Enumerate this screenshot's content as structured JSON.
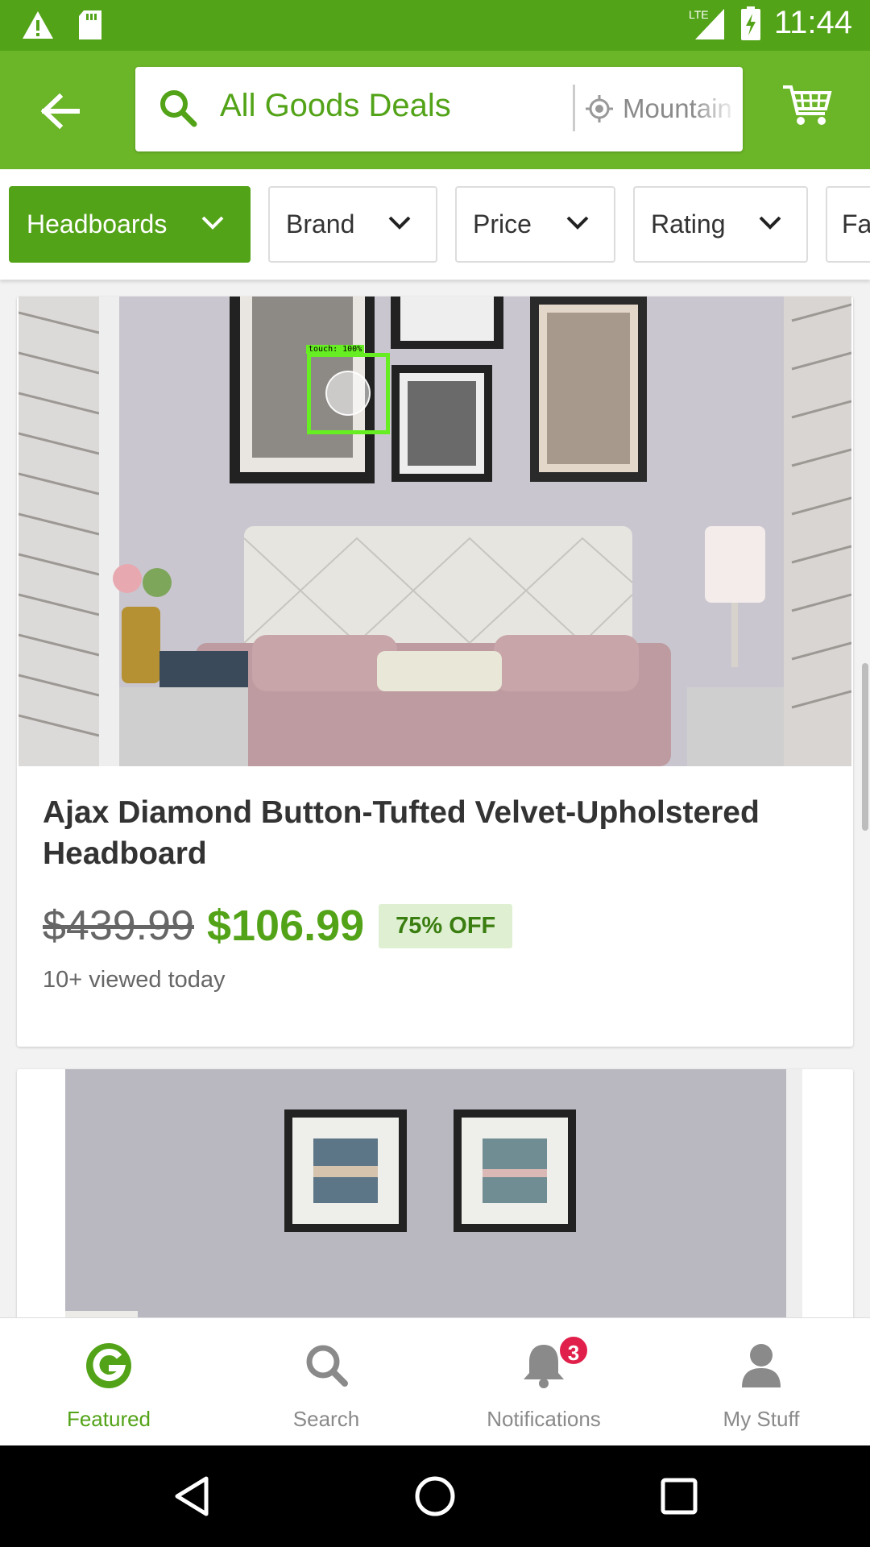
{
  "status_bar": {
    "time": "11:44",
    "network": "LTE",
    "icons": [
      "warning-icon",
      "sd-card-icon",
      "signal-icon",
      "battery-charging-icon"
    ]
  },
  "header": {
    "back_icon": "arrow-left-icon",
    "search_query": "All Goods Deals",
    "location": "Mountain",
    "cart_icon": "cart-icon"
  },
  "filters": [
    {
      "label": "Headboards",
      "active": true
    },
    {
      "label": "Brand",
      "active": false
    },
    {
      "label": "Price",
      "active": false
    },
    {
      "label": "Rating",
      "active": false
    },
    {
      "label": "Fa",
      "active": false
    }
  ],
  "product": {
    "title": "Ajax Diamond Button-Tufted Velvet-Upholstered Headboard",
    "original_price": "$439.99",
    "sale_price": "$106.99",
    "discount": "75% OFF",
    "views": "10+ viewed today"
  },
  "overlay": {
    "touch_label": "touch: 100%"
  },
  "bottom_nav": [
    {
      "label": "Featured",
      "icon": "groupon-g-icon",
      "active": true
    },
    {
      "label": "Search",
      "icon": "search-icon",
      "active": false
    },
    {
      "label": "Notifications",
      "icon": "bell-icon",
      "active": false,
      "badge": "3"
    },
    {
      "label": "My Stuff",
      "icon": "person-icon",
      "active": false
    }
  ],
  "colors": {
    "brand": "#53a318",
    "header": "#6bb528",
    "badge": "#e0204a"
  }
}
